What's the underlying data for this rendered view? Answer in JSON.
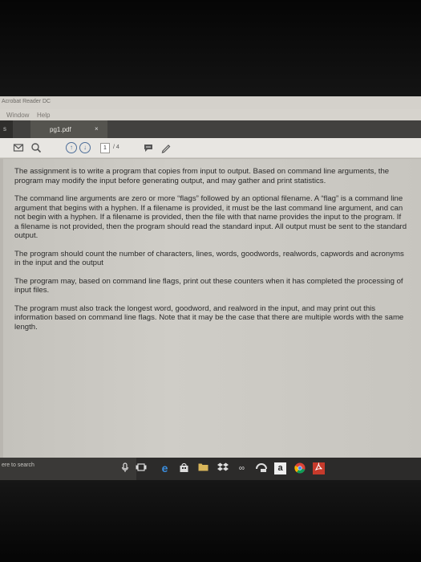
{
  "app": {
    "title": "Acrobat Reader DC"
  },
  "menu": {
    "items": [
      "Window",
      "Help"
    ]
  },
  "tabs": {
    "left_stub": "s",
    "active_tab": "pg1.pdf",
    "close_glyph": "×"
  },
  "toolbar": {
    "icons": [
      "mail-icon",
      "search-icon",
      "page-up-icon",
      "page-down-icon",
      "comment-icon",
      "pen-icon"
    ],
    "current_page": "1",
    "page_total": "/ 4"
  },
  "document": {
    "paragraphs": [
      "The assignment is to write a program that copies from input to output. Based on command line arguments, the program may modify the input before generating output, and may gather and print statistics.",
      "The command line arguments are zero or more “flags” followed by an optional filename. A “flag” is a command line argument that begins with a hyphen. If a filename is provided, it must be the last command line argument, and can not begin with a hyphen. If a filename is provided, then the file with that name provides the input to the program. If a filename is not provided, then the program should read the standard input. All output must be sent to the standard output.",
      "The program should count the number of characters, lines, words, goodwords, realwords, capwords and acronyms in the input and the output",
      "The program may, based on command line flags, print out these counters when it has completed the processing of input files.",
      "The program must also track the longest word, goodword, and realword in the input, and may print out this information based on command line flags. Note that it may be the case that there are multiple words with the same length."
    ]
  },
  "taskbar": {
    "search_text": "ere to search",
    "icons": [
      "microphone-icon",
      "task-view-icon",
      "edge-icon",
      "store-icon",
      "folder-icon",
      "dropbox-icon",
      "link-icon",
      "app-icon",
      "amazon-icon",
      "chrome-icon",
      "acrobat-icon"
    ],
    "amazon_label": "a"
  }
}
